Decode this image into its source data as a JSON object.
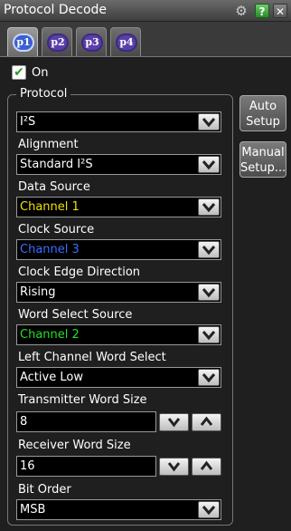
{
  "window": {
    "title": "Protocol Decode"
  },
  "tabs": [
    {
      "label": "p1",
      "active": true
    },
    {
      "label": "p2",
      "active": false
    },
    {
      "label": "p3",
      "active": false
    },
    {
      "label": "p4",
      "active": false
    }
  ],
  "on_checkbox": {
    "label": "On",
    "checked": true
  },
  "protocol_group": {
    "legend": "Protocol",
    "value": "I²S"
  },
  "side_buttons": {
    "auto_setup": {
      "line1": "Auto",
      "line2": "Setup"
    },
    "manual_setup": {
      "line1": "Manual",
      "line2": "Setup..."
    }
  },
  "fields": {
    "alignment": {
      "label": "Alignment",
      "value": "Standard I²S"
    },
    "data_source": {
      "label": "Data Source",
      "value": "Channel 1",
      "color": "#f0e000"
    },
    "clock_source": {
      "label": "Clock Source",
      "value": "Channel 3",
      "color": "#3a6cff"
    },
    "clock_edge": {
      "label": "Clock Edge Direction",
      "value": "Rising"
    },
    "word_select_source": {
      "label": "Word Select Source",
      "value": "Channel 2",
      "color": "#22e022"
    },
    "left_channel": {
      "label": "Left Channel Word Select",
      "value": "Active Low"
    },
    "tx_word_size": {
      "label": "Transmitter Word Size",
      "value": "8"
    },
    "rx_word_size": {
      "label": "Receiver Word Size",
      "value": "16"
    },
    "bit_order": {
      "label": "Bit Order",
      "value": "MSB"
    }
  }
}
